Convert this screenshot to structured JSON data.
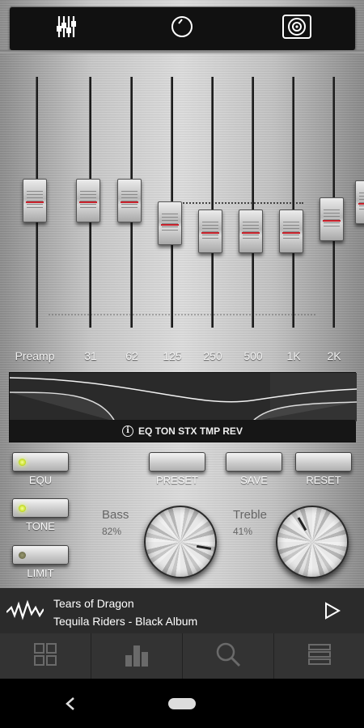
{
  "top_tabs": [
    {
      "name": "equalizer-sliders-icon"
    },
    {
      "name": "knob-circle-icon"
    },
    {
      "name": "speaker-icon"
    }
  ],
  "sliders": [
    {
      "label": "Preamp",
      "level": 0.5
    },
    {
      "label": "31",
      "level": 0.5
    },
    {
      "label": "62",
      "level": 0.5
    },
    {
      "label": "125",
      "level": 0.39
    },
    {
      "label": "250",
      "level": 0.35
    },
    {
      "label": "500",
      "level": 0.35
    },
    {
      "label": "1K",
      "level": 0.35
    },
    {
      "label": "2K",
      "level": 0.41
    }
  ],
  "effects_bar": {
    "text": "EQ TON STX TMP REV",
    "icon": "info-icon"
  },
  "toggles": [
    {
      "label": "EQU",
      "led_on": true
    },
    {
      "label": "TONE",
      "led_on": true
    },
    {
      "label": "LIMIT",
      "led_on": false
    }
  ],
  "actions": {
    "preset": "PRESET",
    "save": "SAVE",
    "reset": "RESET"
  },
  "bass": {
    "label": "Bass",
    "value": "82%"
  },
  "treble": {
    "label": "Treble",
    "value": "41%"
  },
  "now_playing": {
    "title": "Tears of Dragon",
    "subtitle": "Tequila Riders - Black Album",
    "icon": "waveform-icon",
    "play_icon": "play-icon"
  },
  "bottom_nav": [
    "grid-icon",
    "bar-chart-icon",
    "search-icon",
    "list-icon"
  ],
  "colors": {
    "led_on": "#d8f040",
    "marker_red": "#c8202a",
    "panel_dark": "#2a2a2a"
  }
}
